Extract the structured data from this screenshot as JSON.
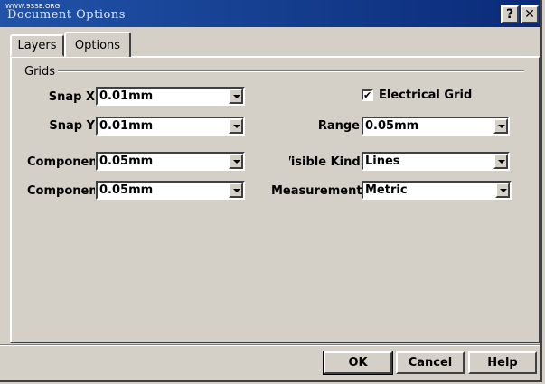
{
  "window": {
    "watermark": "WWW.9SSE.ORG",
    "title": "Document Options",
    "help_glyph": "?",
    "close_glyph": "✕"
  },
  "tabs": [
    {
      "label": "Layers",
      "selected": false
    },
    {
      "label": "Options",
      "selected": true
    }
  ],
  "grids": {
    "label": "Grids",
    "snap_x": {
      "label": "Snap X",
      "value": "0.01mm"
    },
    "snap_y": {
      "label": "Snap Y",
      "value": "0.01mm"
    },
    "component_x": {
      "label": "Component X",
      "value": "0.05mm"
    },
    "component_y": {
      "label": "Component Y",
      "value": "0.05mm"
    },
    "electrical_grid": {
      "label": "Electrical Grid",
      "checked": true,
      "check_glyph": "✔"
    },
    "range": {
      "label": "Range",
      "value": "0.05mm"
    },
    "visible_kind": {
      "label": "Visible Kind",
      "value": "Lines"
    },
    "measurement_unit": {
      "label": "Measurement Unit",
      "value": "Metric"
    }
  },
  "buttons": {
    "ok": "OK",
    "cancel": "Cancel",
    "help": "Help"
  }
}
